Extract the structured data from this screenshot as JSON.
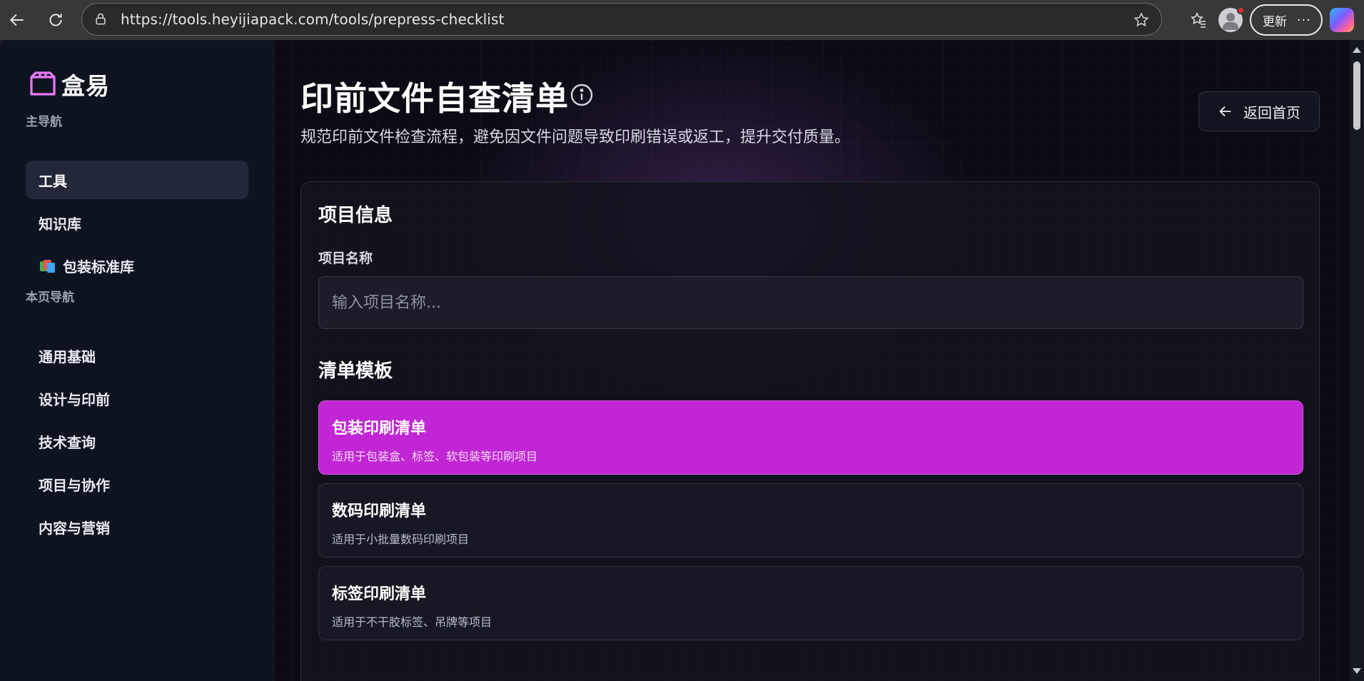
{
  "browser": {
    "url": "https://tools.heyijiapack.com/tools/prepress-checklist",
    "update_label": "更新",
    "more_label": "···"
  },
  "sidebar": {
    "brand_name": "盒易",
    "main_nav_label": "主导航",
    "main_items": [
      {
        "label": "工具",
        "active": true
      },
      {
        "label": "知识库",
        "active": false
      },
      {
        "label": "包装标准库",
        "active": false,
        "icon": "books-icon"
      }
    ],
    "page_nav_label": "本页导航",
    "page_items": [
      {
        "label": "通用基础"
      },
      {
        "label": "设计与印前"
      },
      {
        "label": "技术查询"
      },
      {
        "label": "项目与协作"
      },
      {
        "label": "内容与营销"
      }
    ]
  },
  "main": {
    "title": "印前文件自查清单",
    "subtitle": "规范印前文件检查流程，避免因文件问题导致印刷错误或返工，提升交付质量。",
    "back_label": "返回首页",
    "card": {
      "project_section": "项目信息",
      "project_name_label": "项目名称",
      "project_name_value": "",
      "project_name_placeholder": "输入项目名称...",
      "template_section": "清单模板",
      "templates": [
        {
          "name": "包装印刷清单",
          "desc": "适用于包装盒、标签、软包装等印刷项目",
          "selected": true
        },
        {
          "name": "数码印刷清单",
          "desc": "适用于小批量数码印刷项目",
          "selected": false
        },
        {
          "name": "标签印刷清单",
          "desc": "适用于不干胶标签、吊牌等项目",
          "selected": false
        }
      ]
    }
  },
  "colors": {
    "accent": "#c026d3",
    "sidebar_bg": "#0e1320",
    "page_bg": "#0c0b15"
  }
}
